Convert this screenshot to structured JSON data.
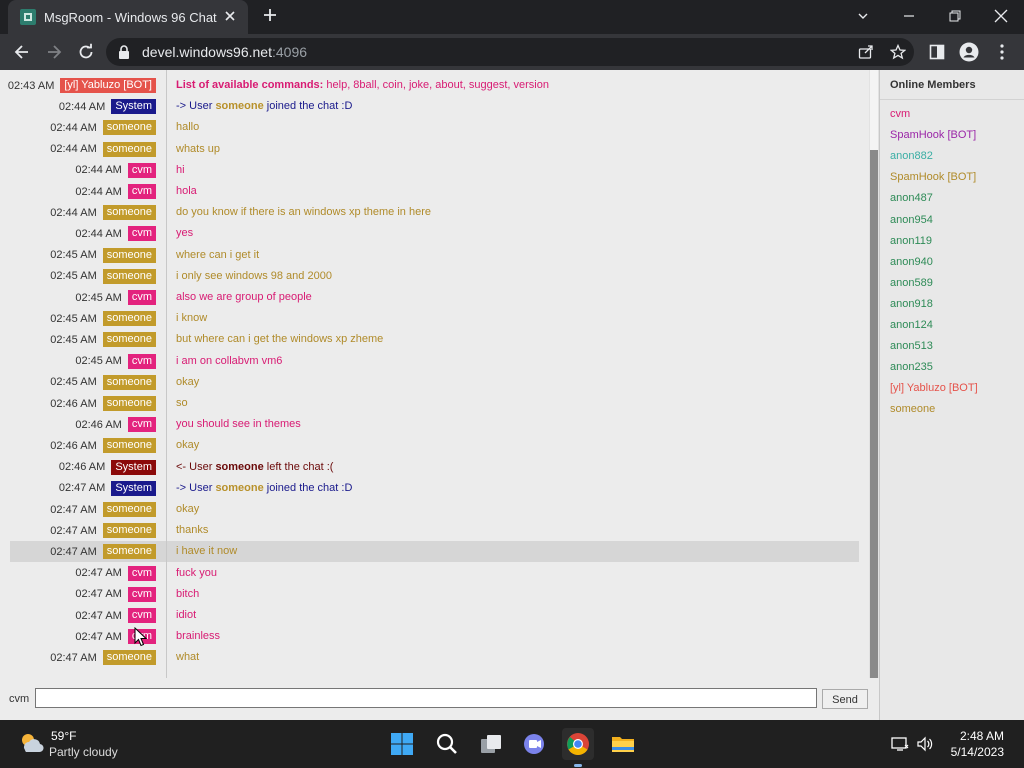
{
  "browser": {
    "tab_title": "MsgRoom - Windows 96 Chat",
    "url_host": "devel.windows96.net",
    "url_port": ":4096"
  },
  "chat": {
    "commands_title": "List of available commands:",
    "commands_list": "help, 8ball, coin, joke, about, suggest, version",
    "messages": [
      {
        "time": "02:43 AM",
        "user": "[yl] Yabluzo [BOT]",
        "user_bg": "#e5534b",
        "kind": "commands"
      },
      {
        "time": "02:44 AM",
        "user": "System",
        "user_bg": "#1a1a8c",
        "pre": "-> User ",
        "who": "someone",
        "post": " joined the chat :D",
        "color": "#1a1a8c",
        "who_color": "#b8912b"
      },
      {
        "time": "02:44 AM",
        "user": "someone",
        "user_bg": "#c29b2b",
        "text": "hallo",
        "color": "#b08b2a"
      },
      {
        "time": "02:44 AM",
        "user": "someone",
        "user_bg": "#c29b2b",
        "text": "whats up",
        "color": "#b08b2a"
      },
      {
        "time": "02:44 AM",
        "user": "cvm",
        "user_bg": "#e3237e",
        "text": "hi",
        "color": "#d81b73"
      },
      {
        "time": "02:44 AM",
        "user": "cvm",
        "user_bg": "#e3237e",
        "text": "hola",
        "color": "#d81b73"
      },
      {
        "time": "02:44 AM",
        "user": "someone",
        "user_bg": "#c29b2b",
        "text": "do you know if there is an windows xp theme in here",
        "color": "#b08b2a"
      },
      {
        "time": "02:44 AM",
        "user": "cvm",
        "user_bg": "#e3237e",
        "text": "yes",
        "color": "#d81b73"
      },
      {
        "time": "02:45 AM",
        "user": "someone",
        "user_bg": "#c29b2b",
        "text": "where can i get it",
        "color": "#b08b2a"
      },
      {
        "time": "02:45 AM",
        "user": "someone",
        "user_bg": "#c29b2b",
        "text": "i only see windows 98 and 2000",
        "color": "#b08b2a"
      },
      {
        "time": "02:45 AM",
        "user": "cvm",
        "user_bg": "#e3237e",
        "text": "also we are group of people",
        "color": "#d81b73"
      },
      {
        "time": "02:45 AM",
        "user": "someone",
        "user_bg": "#c29b2b",
        "text": "i know",
        "color": "#b08b2a"
      },
      {
        "time": "02:45 AM",
        "user": "someone",
        "user_bg": "#c29b2b",
        "text": "but where can i get the windows xp zheme",
        "color": "#b08b2a"
      },
      {
        "time": "02:45 AM",
        "user": "cvm",
        "user_bg": "#e3237e",
        "text": "i am on collabvm vm6",
        "color": "#d81b73"
      },
      {
        "time": "02:45 AM",
        "user": "someone",
        "user_bg": "#c29b2b",
        "text": "okay",
        "color": "#b08b2a"
      },
      {
        "time": "02:46 AM",
        "user": "someone",
        "user_bg": "#c29b2b",
        "text": "so",
        "color": "#b08b2a"
      },
      {
        "time": "02:46 AM",
        "user": "cvm",
        "user_bg": "#e3237e",
        "text": "you should see in themes",
        "color": "#d81b73"
      },
      {
        "time": "02:46 AM",
        "user": "someone",
        "user_bg": "#c29b2b",
        "text": "okay",
        "color": "#b08b2a"
      },
      {
        "time": "02:46 AM",
        "user": "System",
        "user_bg": "#8b0a0a",
        "pre": "<- User ",
        "who": "someone",
        "post": " left the chat :(",
        "color": "#6b0a0a",
        "who_color": "#6b0a0a"
      },
      {
        "time": "02:47 AM",
        "user": "System",
        "user_bg": "#1a1a8c",
        "pre": "-> User ",
        "who": "someone",
        "post": " joined the chat :D",
        "color": "#1a1a8c",
        "who_color": "#b8912b"
      },
      {
        "time": "02:47 AM",
        "user": "someone",
        "user_bg": "#c29b2b",
        "text": "okay",
        "color": "#b08b2a"
      },
      {
        "time": "02:47 AM",
        "user": "someone",
        "user_bg": "#c29b2b",
        "text": "thanks",
        "color": "#b08b2a"
      },
      {
        "time": "02:47 AM",
        "user": "someone",
        "user_bg": "#c29b2b",
        "text": "i have it now",
        "color": "#b08b2a",
        "highlight": true
      },
      {
        "time": "02:47 AM",
        "user": "cvm",
        "user_bg": "#e3237e",
        "text": "fuck you",
        "color": "#d81b73"
      },
      {
        "time": "02:47 AM",
        "user": "cvm",
        "user_bg": "#e3237e",
        "text": "bitch",
        "color": "#d81b73"
      },
      {
        "time": "02:47 AM",
        "user": "cvm",
        "user_bg": "#e3237e",
        "text": "idiot",
        "color": "#d81b73"
      },
      {
        "time": "02:47 AM",
        "user": "cvm",
        "user_bg": "#e3237e",
        "text": "brainless",
        "color": "#d81b73"
      },
      {
        "time": "02:47 AM",
        "user": "someone",
        "user_bg": "#c29b2b",
        "text": "what",
        "color": "#b08b2a"
      }
    ],
    "input_label": "cvm",
    "input_value": "",
    "send_label": "Send"
  },
  "members": {
    "title": "Online Members",
    "list": [
      {
        "name": "cvm",
        "color": "#d81b73"
      },
      {
        "name": "SpamHook [BOT]",
        "color": "#9b27a8"
      },
      {
        "name": "anon882",
        "color": "#3aaea4"
      },
      {
        "name": "SpamHook [BOT]",
        "color": "#b08b2a"
      },
      {
        "name": "anon487",
        "color": "#2e8b57"
      },
      {
        "name": "anon954",
        "color": "#2e8b57"
      },
      {
        "name": "anon119",
        "color": "#2e8b57"
      },
      {
        "name": "anon940",
        "color": "#2e8b57"
      },
      {
        "name": "anon589",
        "color": "#2e8b57"
      },
      {
        "name": "anon918",
        "color": "#2e8b57"
      },
      {
        "name": "anon124",
        "color": "#2e8b57"
      },
      {
        "name": "anon513",
        "color": "#2e8b57"
      },
      {
        "name": "anon235",
        "color": "#2e8b57"
      },
      {
        "name": "[yl] Yabluzo [BOT]",
        "color": "#e5534b"
      },
      {
        "name": "someone",
        "color": "#b08b2a"
      }
    ]
  },
  "taskbar": {
    "temperature": "59°F",
    "condition": "Partly cloudy",
    "time": "2:48 AM",
    "date": "5/14/2023"
  }
}
